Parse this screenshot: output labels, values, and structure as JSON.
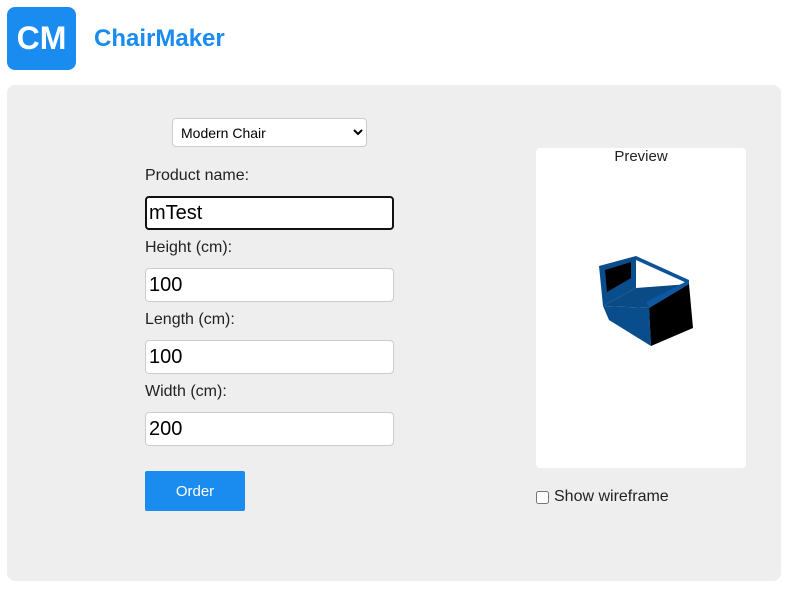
{
  "header": {
    "logo_text": "CM",
    "app_title": "ChairMaker"
  },
  "form": {
    "model_select": {
      "selected": "Modern Chair",
      "options": [
        "Modern Chair"
      ]
    },
    "product_name": {
      "label": "Product name:",
      "value": "mTest"
    },
    "height": {
      "label": "Height (cm):",
      "value": "100"
    },
    "length": {
      "label": "Length (cm):",
      "value": "100"
    },
    "width": {
      "label": "Width (cm):",
      "value": "200"
    },
    "order_label": "Order"
  },
  "preview": {
    "title": "Preview",
    "chair_color": "#0a4d8c",
    "chair_shadow_color": "#000000"
  },
  "wireframe": {
    "label": "Show wireframe",
    "checked": false
  },
  "colors": {
    "accent": "#1a8cf0",
    "panel_bg": "#eeeeee"
  }
}
